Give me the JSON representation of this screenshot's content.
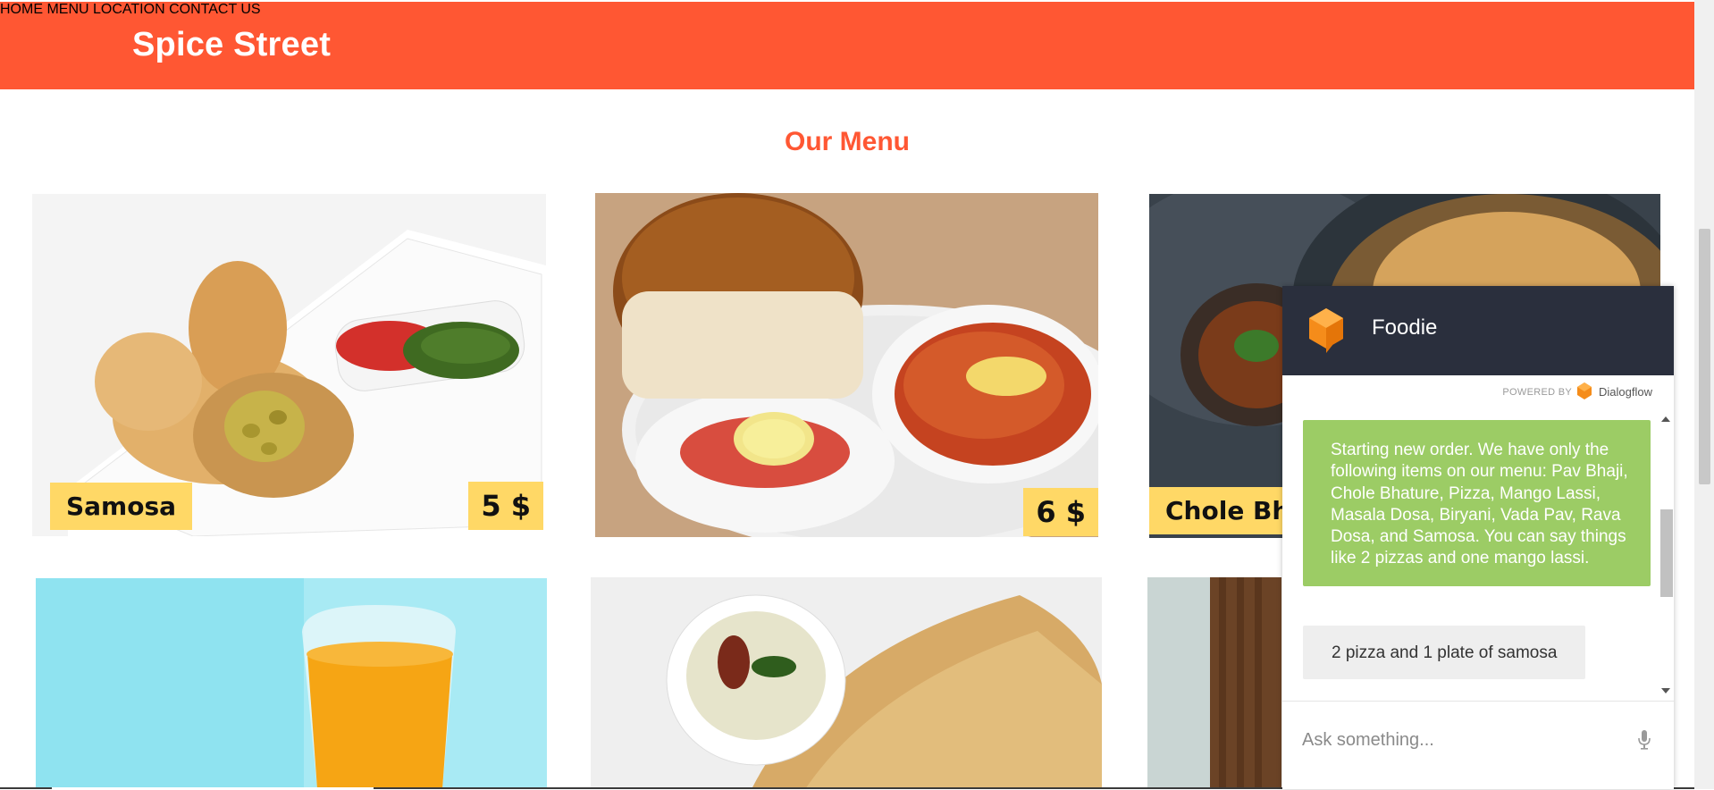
{
  "header": {
    "brand": "Spice Street",
    "nav": [
      "HOME",
      "MENU",
      "LOCATION",
      "CONTACT US"
    ]
  },
  "main": {
    "title": "Our Menu",
    "items": [
      {
        "name": "Samosa",
        "price": "5 $"
      },
      {
        "name": "",
        "price": "6 $"
      },
      {
        "name": "Chole Bha",
        "price": ""
      }
    ]
  },
  "chat": {
    "agent_name": "Foodie",
    "powered_by": "POWERED BY",
    "provider": "Dialogflow",
    "messages": [
      {
        "from": "bot",
        "text": "Starting new order. We have only the following items on our menu: Pav Bhaji, Chole Bhature, Pizza, Mango Lassi, Masala Dosa, Biryani, Vada Pav, Rava Dosa, and Samosa. You can say things like 2 pizzas and one mango lassi."
      },
      {
        "from": "user",
        "text": "2 pizza and 1 plate of samosa"
      }
    ],
    "input_placeholder": "Ask something..."
  },
  "colors": {
    "brand": "#ff5733",
    "chat_header": "#2a2f3d",
    "bot_bubble": "#9ccc65",
    "tag": "#ffd866"
  },
  "icons": [
    "dialogflow-logo-icon",
    "mic-icon",
    "chat-avatar-icon"
  ]
}
